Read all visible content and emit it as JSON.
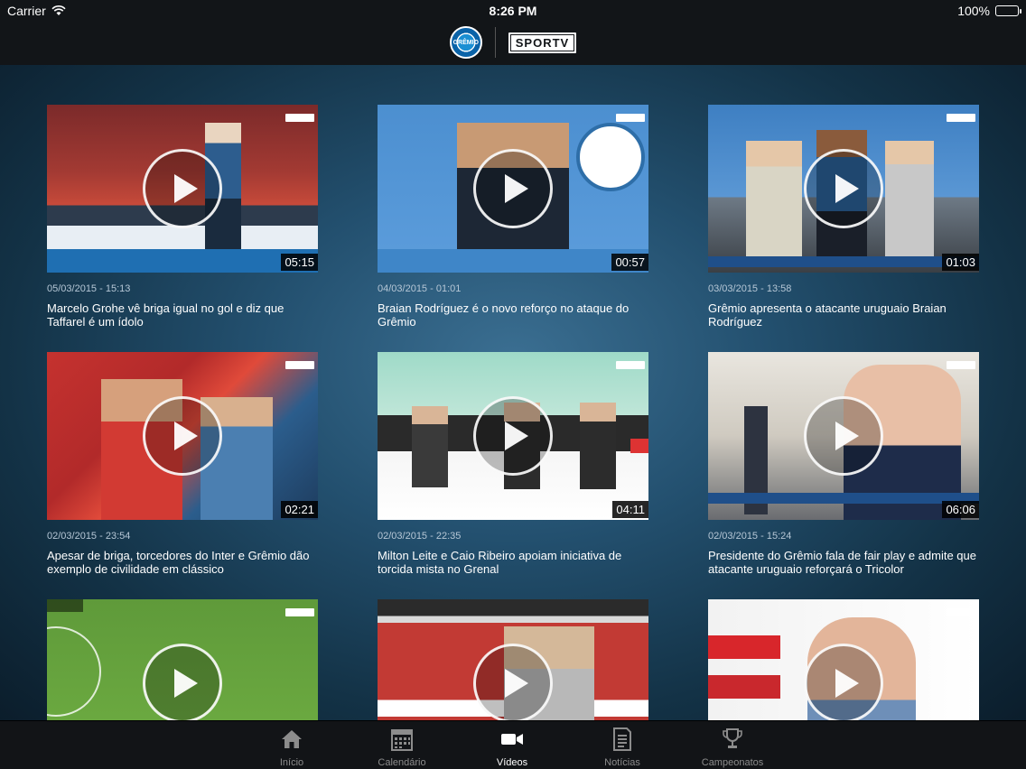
{
  "status_bar": {
    "carrier": "Carrier",
    "time": "8:26 PM",
    "battery": "100%"
  },
  "header": {
    "club_logo_text": "GRÊMIO",
    "channel_logo_text": "SPORTV"
  },
  "videos": [
    {
      "date": "05/03/2015 - 15:13",
      "title": "Marcelo Grohe vê briga igual no gol e diz que Taffarel é um ídolo",
      "duration": "05:15"
    },
    {
      "date": "04/03/2015 - 01:01",
      "title": "Braian Rodríguez é o novo reforço no ataque do Grêmio",
      "duration": "00:57"
    },
    {
      "date": "03/03/2015 - 13:58",
      "title": "Grêmio apresenta o atacante uruguaio Braian Rodríguez",
      "duration": "01:03"
    },
    {
      "date": "02/03/2015 - 23:54",
      "title": "Apesar de briga, torcedores do Inter e Grêmio dão exemplo de civilidade em clássico",
      "duration": "02:21"
    },
    {
      "date": "02/03/2015 - 22:35",
      "title": "Milton Leite e Caio Ribeiro apoiam iniciativa de torcida mista no Grenal",
      "duration": "04:11"
    },
    {
      "date": "02/03/2015 - 15:24",
      "title": "Presidente do Grêmio fala de fair play e admite que atacante uruguaio reforçará o Tricolor",
      "duration": "06:06"
    },
    {
      "date": "",
      "title": "",
      "duration": ""
    },
    {
      "date": "",
      "title": "",
      "duration": ""
    },
    {
      "date": "",
      "title": "",
      "duration": ""
    }
  ],
  "tabs": [
    {
      "label": "Início",
      "icon": "home-icon"
    },
    {
      "label": "Calendário",
      "icon": "calendar-icon"
    },
    {
      "label": "Vídeos",
      "icon": "video-camera-icon"
    },
    {
      "label": "Notícias",
      "icon": "newspaper-icon"
    },
    {
      "label": "Campeonatos",
      "icon": "trophy-icon"
    }
  ],
  "active_tab": "Vídeos",
  "colors": {
    "active_tab": "#ffffff",
    "inactive_tab": "#8c8c8c",
    "bar_background": "#121518"
  }
}
